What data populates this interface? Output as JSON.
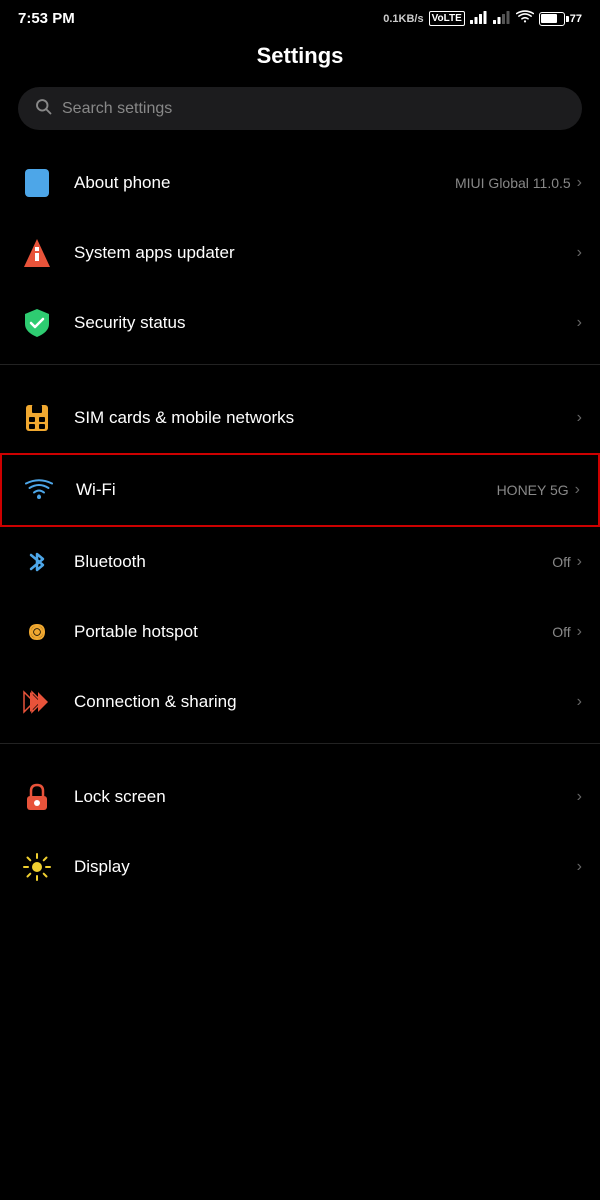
{
  "statusBar": {
    "time": "7:53 PM",
    "speed": "0.1KB/s",
    "networkType": "VoLTE",
    "battery": 77
  },
  "pageTitle": "Settings",
  "search": {
    "placeholder": "Search settings"
  },
  "sections": [
    {
      "id": "system",
      "items": [
        {
          "id": "about-phone",
          "label": "About phone",
          "value": "MIUI Global 11.0.5",
          "icon": "phone",
          "chevron": true
        },
        {
          "id": "system-apps-updater",
          "label": "System apps updater",
          "value": "",
          "icon": "updater",
          "chevron": true
        },
        {
          "id": "security-status",
          "label": "Security status",
          "value": "",
          "icon": "shield",
          "chevron": true
        }
      ]
    },
    {
      "id": "connectivity",
      "items": [
        {
          "id": "sim-cards",
          "label": "SIM cards & mobile networks",
          "value": "",
          "icon": "sim",
          "chevron": true
        },
        {
          "id": "wifi",
          "label": "Wi-Fi",
          "value": "HONEY 5G",
          "icon": "wifi",
          "chevron": true,
          "highlighted": true
        },
        {
          "id": "bluetooth",
          "label": "Bluetooth",
          "value": "Off",
          "icon": "bluetooth",
          "chevron": true
        },
        {
          "id": "hotspot",
          "label": "Portable hotspot",
          "value": "Off",
          "icon": "hotspot",
          "chevron": true
        },
        {
          "id": "connection-sharing",
          "label": "Connection & sharing",
          "value": "",
          "icon": "connection",
          "chevron": true
        }
      ]
    },
    {
      "id": "personalization",
      "items": [
        {
          "id": "lock-screen",
          "label": "Lock screen",
          "value": "",
          "icon": "lock",
          "chevron": true
        },
        {
          "id": "display",
          "label": "Display",
          "value": "",
          "icon": "display",
          "chevron": true
        }
      ]
    }
  ],
  "chevronSymbol": "›",
  "labels": {
    "wifi": "Wi-Fi",
    "bluetooth": "Bluetooth",
    "hotspot": "Portable hotspot",
    "connection": "Connection & sharing",
    "lock": "Lock screen",
    "display": "Display",
    "sim": "SIM cards & mobile networks",
    "about": "About phone",
    "updater": "System apps updater",
    "security": "Security status"
  }
}
